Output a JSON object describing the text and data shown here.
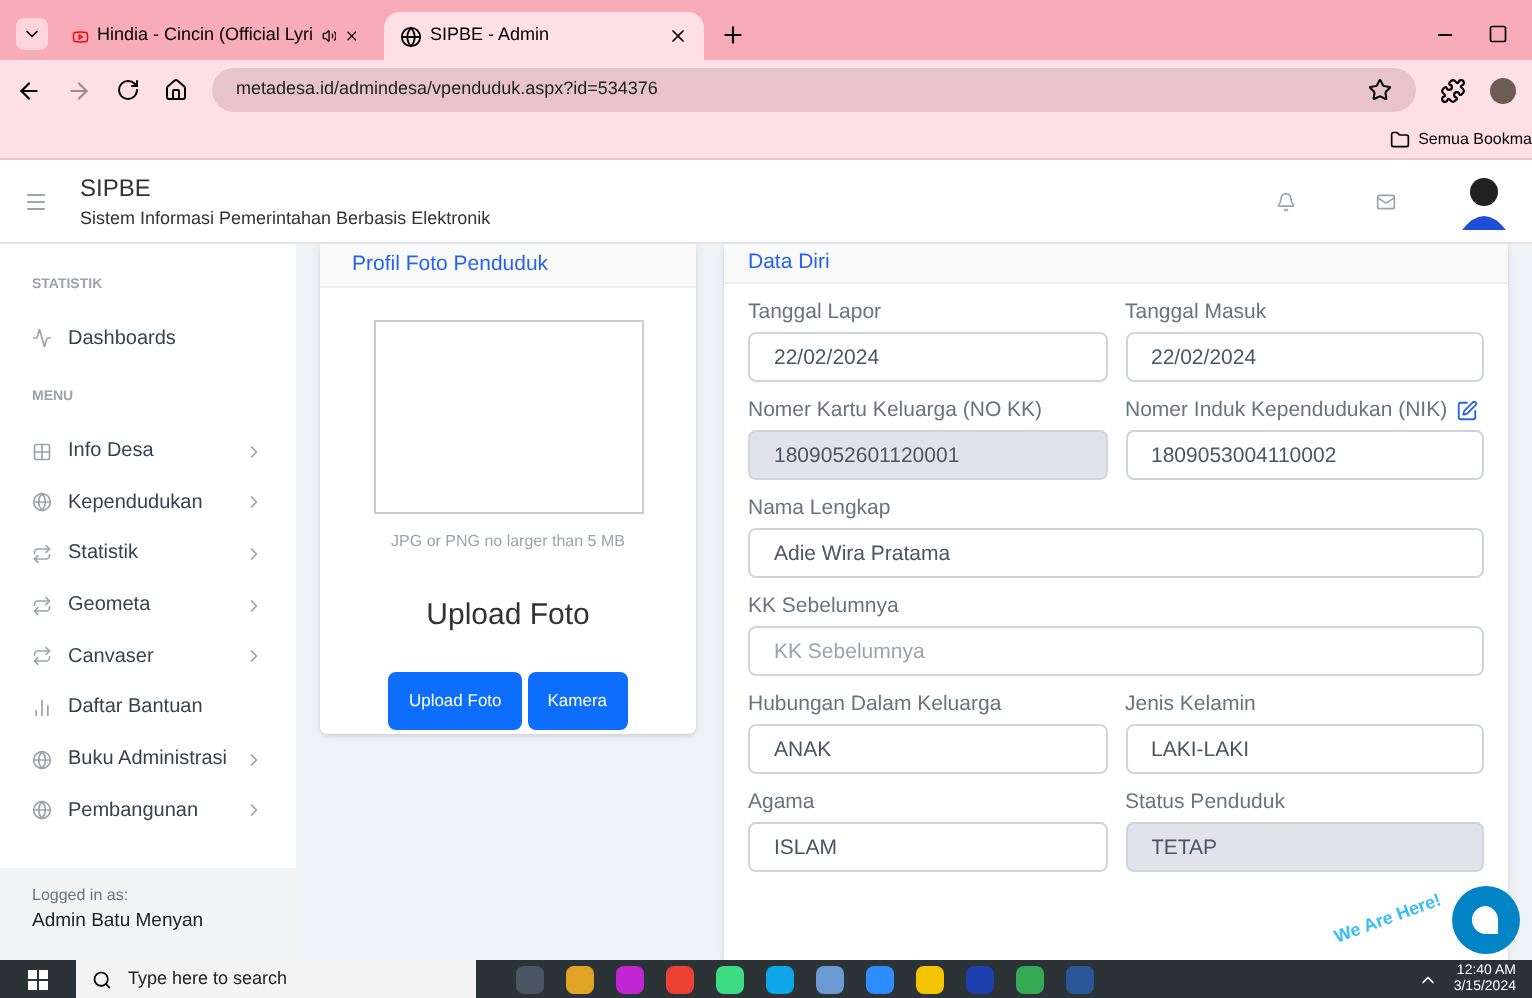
{
  "browser": {
    "tabs": [
      {
        "title": "Hindia - Cincin (Official Lyri",
        "selected": false,
        "audio": true
      },
      {
        "title": "SIPBE - Admin",
        "selected": true,
        "audio": false
      }
    ],
    "url": "metadesa.id/admindesa/vpenduduk.aspx?id=534376",
    "bookmarks_folder": "Semua Bookma"
  },
  "header": {
    "title": "SIPBE",
    "subtitle": "Sistem Informasi Pemerintahan Berbasis Elektronik"
  },
  "sidebar": {
    "sections": [
      {
        "heading": "STATISTIK",
        "items": [
          {
            "label": "Dashboards",
            "has_submenu": false
          }
        ]
      },
      {
        "heading": "MENU",
        "items": [
          {
            "label": "Info Desa",
            "has_submenu": true
          },
          {
            "label": "Kependudukan",
            "has_submenu": true
          },
          {
            "label": "Statistik",
            "has_submenu": true
          },
          {
            "label": "Geometa",
            "has_submenu": true
          },
          {
            "label": "Canvaser",
            "has_submenu": true
          },
          {
            "label": "Daftar Bantuan",
            "has_submenu": false
          },
          {
            "label": "Buku Administrasi",
            "has_submenu": true
          },
          {
            "label": "Pembangunan",
            "has_submenu": true
          }
        ]
      }
    ],
    "footer": {
      "caption": "Logged in as:",
      "user": "Admin Batu Menyan"
    }
  },
  "photo_card": {
    "title": "Profil Foto Penduduk",
    "hint": "JPG or PNG no larger than 5 MB",
    "heading": "Upload Foto",
    "buttons": [
      "Upload Foto",
      "Kamera"
    ]
  },
  "form": {
    "title": "Data Diri",
    "rows": [
      [
        {
          "label": "Tanggal Lapor",
          "value": "22/02/2024",
          "disabled": false
        },
        {
          "label": "Tanggal Masuk",
          "value": "22/02/2024",
          "disabled": false
        }
      ],
      [
        {
          "label": "Nomer Kartu Keluarga (NO KK)",
          "value": "1809052601120001",
          "disabled": true
        },
        {
          "label": "Nomer Induk Kependudukan (NIK)",
          "value": "1809053004110002",
          "disabled": false,
          "edit_icon": true
        }
      ],
      [
        {
          "label": "Nama Lengkap",
          "value": "Adie Wira Pratama",
          "disabled": false
        }
      ],
      [
        {
          "label": "KK Sebelumnya",
          "placeholder": "KK Sebelumnya",
          "disabled": false
        }
      ],
      [
        {
          "label": "Hubungan Dalam Keluarga",
          "value": "ANAK",
          "disabled": false
        },
        {
          "label": "Jenis Kelamin",
          "value": "LAKI-LAKI",
          "disabled": false
        }
      ],
      [
        {
          "label": "Agama",
          "value": "ISLAM",
          "disabled": false
        },
        {
          "label": "Status Penduduk",
          "value": "TETAP",
          "disabled": true
        }
      ]
    ]
  },
  "chat_widget": {
    "caption": "We Are Here!"
  },
  "taskbar": {
    "search_placeholder": "Type here to search",
    "apps": [
      {
        "color": "#4b5563"
      },
      {
        "color": "#e0a526"
      },
      {
        "color": "#c026d3"
      },
      {
        "color": "#ea4335"
      },
      {
        "color": "#3ddc84"
      },
      {
        "color": "#0ea5e9"
      },
      {
        "color": "#6b9bd2"
      },
      {
        "color": "#2d8cff"
      },
      {
        "color": "#f5c400"
      },
      {
        "color": "#1e40af"
      },
      {
        "color": "#34a853"
      },
      {
        "color": "#2b579a"
      }
    ],
    "time": "12:40 AM",
    "date": "3/15/2024"
  }
}
